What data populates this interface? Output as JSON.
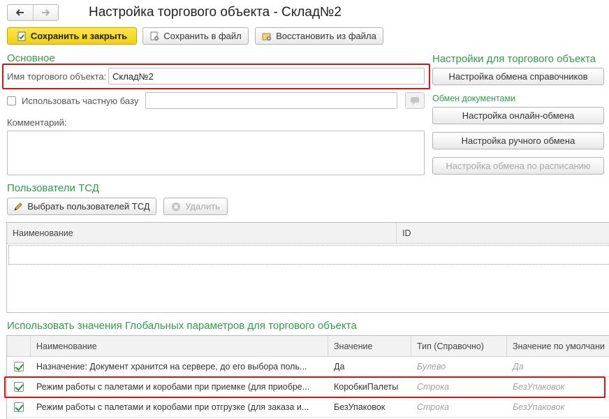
{
  "window": {
    "title": "Настройка торгового объекта - Склад№2",
    "back_icon": "arrow-left-icon",
    "forward_icon": "arrow-right-icon"
  },
  "toolbar": {
    "save_close": "Сохранить и закрыть",
    "save_file": "Сохранить в файл",
    "restore_file": "Восстановить из файла"
  },
  "basic": {
    "section_title": "Основное",
    "name_label": "Имя торгового объекта:",
    "name_value": "Склад№2",
    "private_base_label": "Использовать частную базу",
    "private_base_value": "",
    "comment_label": "Комментарий:",
    "comment_value": ""
  },
  "settings": {
    "section_title": "Настройки для торгового объекта",
    "exchange_refs": "Настройка обмена справочников",
    "doc_exchange_title": "Обмен документами",
    "online_exchange": "Настройка онлайн-обмена",
    "manual_exchange": "Настройка ручного обмена",
    "schedule_exchange": "Настройка обмена по расписанию"
  },
  "users": {
    "section_title": "Пользователи ТСД",
    "select_button": "Выбрать пользователей ТСД",
    "delete_button": "Удалить",
    "columns": [
      "Наименование",
      "ID"
    ]
  },
  "global": {
    "section_title": "Использовать значения Глобальных параметров для торгового объекта",
    "columns": [
      "Наименование",
      "Значение",
      "Тип (Справочно)",
      "Значение по умолчани"
    ],
    "rows": [
      {
        "checked": true,
        "name": "Назначение: Документ хранится на сервере, до его выбора поль...",
        "value": "Да",
        "type": "Булево",
        "default": "Да"
      },
      {
        "checked": true,
        "name": "Режим работы с палетами и коробами при приемке (для приобре...",
        "value": "КоробкиПалеты",
        "type": "Строка",
        "default": "БезУпаковок"
      },
      {
        "checked": true,
        "name": "Режим работы с палетами и коробами при отгрузке (для заказа и...",
        "value": "БезУпаковок",
        "type": "Строка",
        "default": "БезУпаковок"
      }
    ]
  },
  "colors": {
    "accent_green": "#2e9d48",
    "primary_yellow": "#f2cf14",
    "highlight_red": "#e01010"
  }
}
